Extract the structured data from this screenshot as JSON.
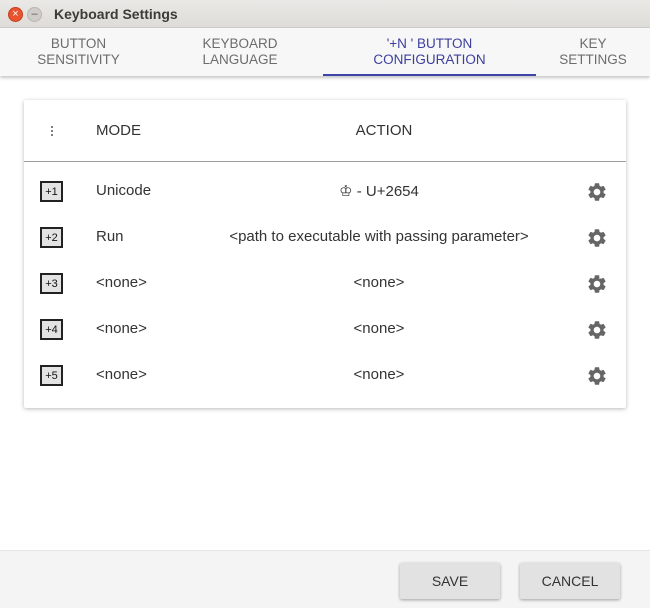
{
  "window": {
    "title": "Keyboard Settings",
    "close_glyph": "×",
    "minimize_glyph": "–"
  },
  "tabs": [
    {
      "label": "BUTTON\nSENSITIVITY",
      "active": false
    },
    {
      "label": "KEYBOARD\nLANGUAGE",
      "active": false
    },
    {
      "label": "'+N ' BUTTON\nCONFIGURATION",
      "active": true
    },
    {
      "label": "KEY\nSETTINGS",
      "active": false
    }
  ],
  "table": {
    "headers": {
      "mode": "MODE",
      "action": "ACTION"
    },
    "rows": [
      {
        "key": "+1",
        "mode": "Unicode",
        "action": "♔ - U+2654"
      },
      {
        "key": "+2",
        "mode": "Run",
        "action": "<path to executable with passing parameter>"
      },
      {
        "key": "+3",
        "mode": "<none>",
        "action": "<none>"
      },
      {
        "key": "+4",
        "mode": "<none>",
        "action": "<none>"
      },
      {
        "key": "+5",
        "mode": "<none>",
        "action": "<none>"
      }
    ],
    "row_icon": "gear-icon"
  },
  "footer": {
    "save_label": "SAVE",
    "cancel_label": "CANCEL"
  },
  "colors": {
    "accent": "#3f44a8",
    "close": "#e9542f"
  }
}
